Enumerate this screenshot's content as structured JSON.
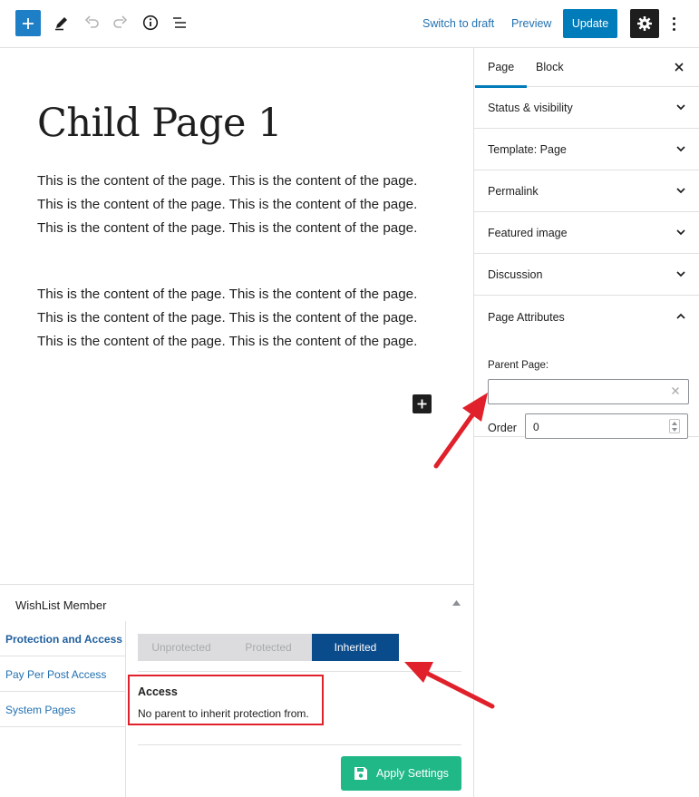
{
  "toolbar": {
    "switch_to_draft": "Switch to draft",
    "preview": "Preview",
    "update": "Update"
  },
  "editor": {
    "title": "Child Page 1",
    "paragraphs": [
      "This is the content of the page. This is the content of the page. This is the content of the page. This is the content of the page. This is the content of the page. This is the content of the page.",
      "This is the content of the page. This is the content of the page. This is the content of the page. This is the content of the page. This is the content of the page. This is the content of the page."
    ]
  },
  "sidebar": {
    "tabs": [
      {
        "label": "Page",
        "active": true
      },
      {
        "label": "Block",
        "active": false
      }
    ],
    "panels": [
      {
        "label": "Status & visibility"
      },
      {
        "label": "Template: Page"
      },
      {
        "label": "Permalink"
      },
      {
        "label": "Featured image"
      },
      {
        "label": "Discussion"
      }
    ],
    "page_attributes": {
      "title": "Page Attributes",
      "parent_label": "Parent Page:",
      "parent_value": "",
      "order_label": "Order",
      "order_value": "0"
    }
  },
  "metabox": {
    "title": "WishList Member",
    "nav": [
      {
        "label": "Protection and Access",
        "active": true
      },
      {
        "label": "Pay Per Post Access",
        "active": false
      },
      {
        "label": "System Pages",
        "active": false
      }
    ],
    "segments": [
      {
        "label": "Unprotected",
        "active": false
      },
      {
        "label": "Protected",
        "active": false
      },
      {
        "label": "Inherited",
        "active": true
      }
    ],
    "access_title": "Access",
    "access_text": "No parent to inherit protection from.",
    "apply_label": "Apply Settings"
  },
  "colors": {
    "accent": "#007cba",
    "segment_active": "#0a4b8c",
    "apply": "#20b887",
    "highlight": "#e0202a"
  }
}
